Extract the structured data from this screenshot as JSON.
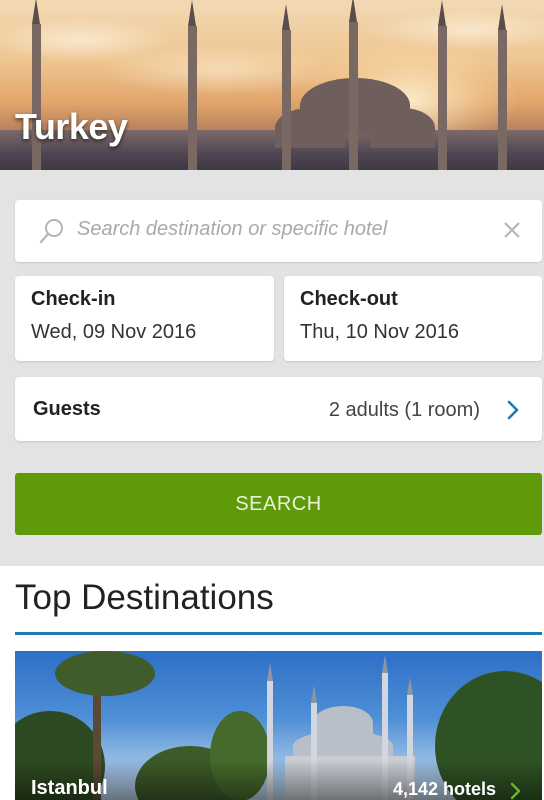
{
  "hero": {
    "title": "Turkey"
  },
  "search": {
    "placeholder": "Search destination or specific hotel"
  },
  "checkin": {
    "label": "Check-in",
    "value": "Wed, 09 Nov 2016"
  },
  "checkout": {
    "label": "Check-out",
    "value": "Thu, 10 Nov 2016"
  },
  "guests": {
    "label": "Guests",
    "value": "2 adults (1 room)"
  },
  "search_button": {
    "label": "SEARCH"
  },
  "destinations": {
    "heading": "Top Destinations",
    "items": [
      {
        "name": "Istanbul",
        "count": "4,142 hotels"
      }
    ]
  },
  "colors": {
    "accent_green": "#5f9a0b",
    "accent_blue": "#1c7bb0"
  },
  "icons": {
    "search": "search-icon",
    "clear": "close-icon",
    "guests_chevron": "chevron-right-icon",
    "destination_chevron": "chevron-right-icon"
  }
}
